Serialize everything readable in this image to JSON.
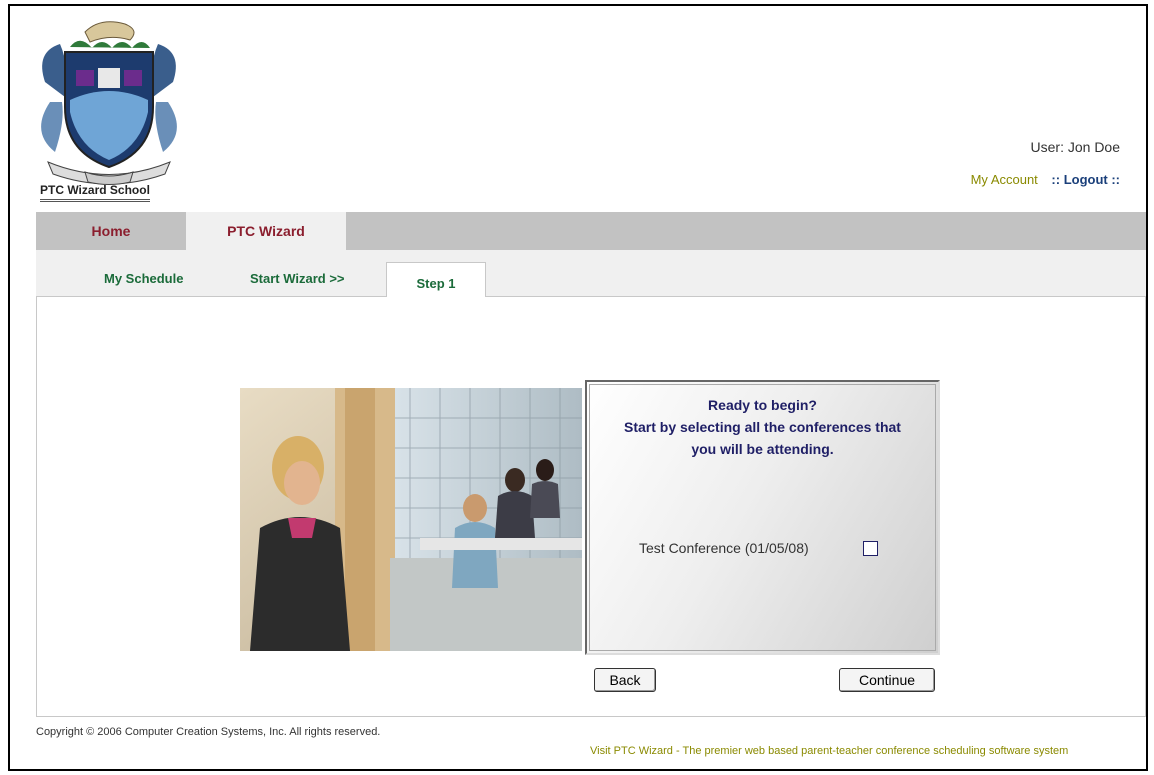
{
  "school": {
    "name": "PTC Wizard School",
    "logo_icon": "school-crest-icon"
  },
  "header": {
    "user_label": "User: Jon Doe",
    "my_account": "My Account",
    "logout": ":: Logout ::"
  },
  "main_tabs": [
    {
      "label": "Home",
      "active": false
    },
    {
      "label": "PTC Wizard",
      "active": true
    }
  ],
  "sub_tabs": [
    {
      "label": "My Schedule",
      "active": false
    },
    {
      "label": "Start Wizard >>",
      "active": false
    },
    {
      "label": "Step 1",
      "active": true
    }
  ],
  "panel": {
    "line1": "Ready to begin?",
    "line2": "Start by selecting all the conferences that",
    "line3": "you will be attending.",
    "conference_label": "Test Conference (01/05/08)",
    "conference_checked": false
  },
  "buttons": {
    "back": "Back",
    "continue": "Continue"
  },
  "footer": {
    "copyright": "Copyright © 2006 Computer Creation Systems, Inc. All rights reserved.",
    "link": "Visit PTC Wizard - The premier web based parent-teacher conference scheduling software system"
  },
  "colors": {
    "tab_text": "#8b1e2e",
    "subtab_text": "#1b6b3a",
    "panel_text": "#1f1f66",
    "footer_link": "#8a8a00"
  }
}
